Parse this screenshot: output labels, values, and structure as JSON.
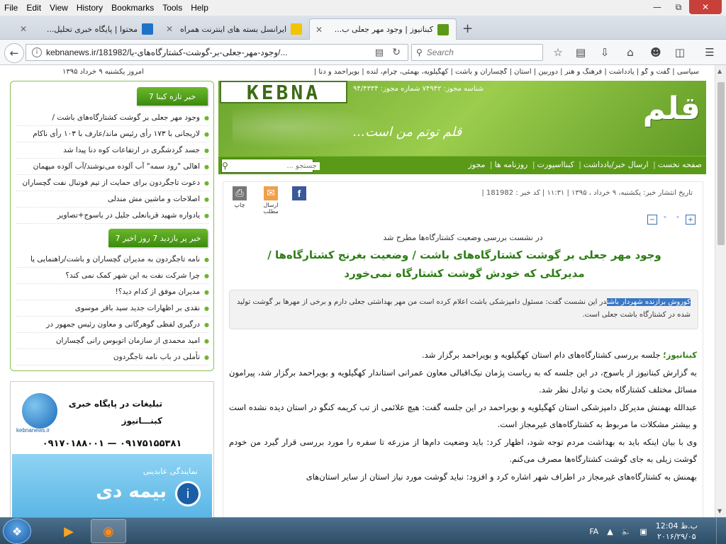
{
  "menubar": {
    "items": [
      "File",
      "Edit",
      "View",
      "History",
      "Bookmarks",
      "Tools",
      "Help"
    ]
  },
  "tabs": [
    {
      "label": "محتوا | پایگاه خبری تحلیل...",
      "active": false
    },
    {
      "label": "ایرانسل بسته های اینترنت همراه",
      "active": false
    },
    {
      "label": "کبنانیوز | وجود مهر جعلی ب...",
      "active": true
    }
  ],
  "navbar": {
    "url": "kebnanews.ir/181982/وجود-مهر-جعلی-بر-گوشت-کشتارگاه‌های-با/...",
    "search_placeholder": "Search"
  },
  "topnav": {
    "links": "سیاسی | گفت و گو | یادداشت | فرهنگ و هنر | دوربین | استان | گچساران و باشت | کهگیلویه، بهمئی، چرام، لنده | بویراحمد و دنا |",
    "date": "امروز یکشنبه ۹ خرداد ۱۳۹۵"
  },
  "header": {
    "logo": "KEBNA",
    "license": "شناسه مجوز: ۷۴۹۴۲  شماره مجوز: ۹۴/۴۳۳۴",
    "slogan": "قلم توتم من است...",
    "slogan_big": "قلم"
  },
  "mainnav": {
    "items": [
      "صفحه نخست",
      "ارسال خبر/یادداشت",
      "کبنااسپورت",
      "روزنامه ها",
      "مجوز"
    ],
    "search_placeholder": "جستجو ..."
  },
  "sidebar": {
    "new_header": "7 خبر تازه کبنا",
    "new_items": [
      "وجود مهر جعلی بر گوشت کشتارگاه‌های باشت /",
      "لاریجانی با ۱۷۳ رأی رئیس ماند/عارف با ۱۰۳ رأی ناکام",
      "جسد گردشگری در ارتفاعات کوه دنا پیدا شد",
      "اهالی \"رود سمه\" آب آلوده می‌نوشند/آب آلوده میهمان",
      "دعوت تاجگردون برای حمایت از تیم فوتبال نفت گچساران",
      "اصلاحات و ماشین مش مندلی",
      "یادواره شهید قربانعلی جلیل در یاسوج+تصاویر"
    ],
    "popular_header": "7 خبر پر بازدید 7 روز اخیر",
    "popular_items": [
      "نامه تاجگردون به مدیران گچساران و باشت/راهنمایی یا",
      "چرا شرکت نفت به این شهر کمک نمی کند؟",
      "مدیران موفق از کدام دید؟!",
      "نقدی بر اظهارات جدید سید باقر موسوی",
      "درگیری لفظی گوهرگانی و معاون رئیس جمهور در",
      "امید محمدی از سازمان اتوبوس رانی گچساران",
      "تأملی در باب نامه تاجگردون"
    ]
  },
  "ad": {
    "title": "تبلیغات در پایگاه خبری",
    "subtitle": "کبنـــانیوز",
    "phones": "۰۹۱۷۵۱۵۵۳۸۱ — ۰۹۱۷۰۱۸۸۰۰۱",
    "domain": "kebnanews.ir",
    "ad2_title": "نمایندگی عابدینی",
    "ad2_brand": "بیمه دی",
    "ad2_logo": "i"
  },
  "article": {
    "meta": "تاریخ انتشار خبر: یکشنبه، ۹ خرداد ، ۱۳۹۵ | ۱۱:۳۱ | کد خبر : 181982 |",
    "share_fb": "f",
    "share_mail": "ارسال مطلب",
    "share_print": "چاپ",
    "supertitle": "در نشست بررسی وضعیت کشتارگاه‌ها مطرح شد",
    "headline": "وجود مهر جعلی بر گوشت کشتارگاه‌های باشت / وضعیت بغرنج کشتارگاه‌ها / مدیرکلی که خودش گوشت کشتارگاه نمی‌خورد",
    "lead_highlight": "کوروش برازنده شهردار باشت",
    "lead_rest": "در این نشست گفت: مسئول دامپزشکی باشت اعلام کرده است من مهر بهداشتی جعلی دارم و برخی از مهرها بر گوشت تولید شده در کشتارگاه باشت جعلی است.",
    "source": "کبنانیوز؛",
    "p1": "جلسه بررسی کشتارگاه‌های دام استان کهگیلویه و بویراحمد برگزار شد.",
    "p2": "به گزارش کبنانیوز از یاسوج، در این جلسه که به ریاست پژمان نیک‌اقبالی معاون عمرانی استاندار کهگیلویه و بویراحمد برگزار شد، پیرامون مسائل مختلف کشتارگاه بحث و تبادل نظر شد.",
    "p3": "عبدالله بهمنش مدیرکل دامپزشکی استان کهگیلویه و بویراحمد در این جلسه گفت: هیچ علائمی از تب کریمه کنگو در استان دیده نشده است و بیشتر مشکلات ما مربوط به کشتارگاه‌های غیرمجاز است.",
    "p4": "وی با بیان اینکه باید به بهداشت مردم توجه شود، اظهار کرد: باید وضعیت دام‌ها از مزرعه تا سفره را مورد بررسی قرار گیرد من خودم گوشت زیلی به جای گوشت کشتارگاه‌ها مصرف می‌کنم.",
    "p5": "بهمنش به کشتارگاه‌های غیرمجاز در اطراف شهر اشاره کرد و افزود: نباید گوشت مورد نیاز استان از سایر استان‌های"
  },
  "taskbar": {
    "lang": "FA",
    "time": "12:04 ب.ظ",
    "date": "۲۰۱۶/۲۹/۰۵"
  },
  "colors": {
    "brand_green": "#5a9a18",
    "headline_green": "#2c7d14",
    "highlight_blue": "#3a78c4"
  }
}
